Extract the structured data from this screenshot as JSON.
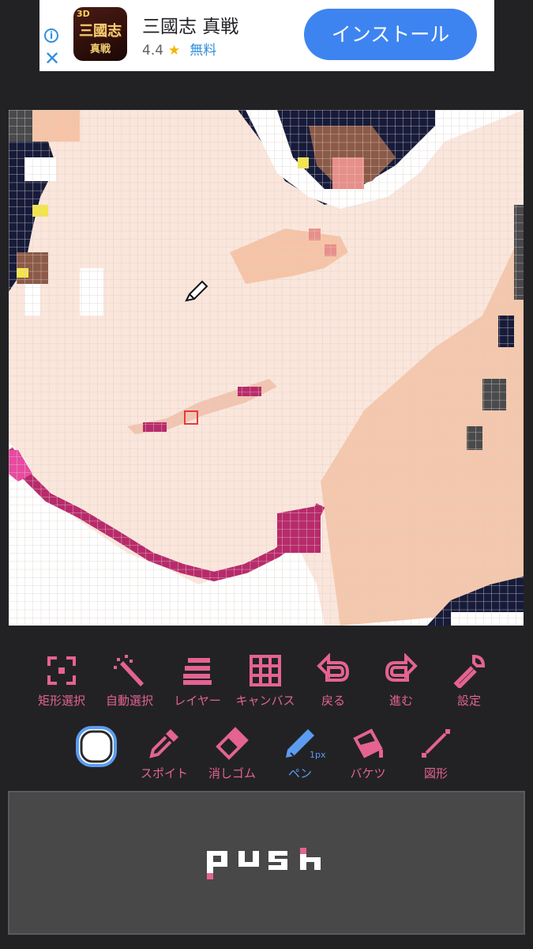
{
  "ad": {
    "app_name": "三國志 真戦",
    "rating": "4.4",
    "price": "無料",
    "install_label": "インストール",
    "icon_badge": "3D",
    "icon_title": "三國志",
    "icon_subtitle": "真戦"
  },
  "toolbar_row1": [
    {
      "label": "矩形選択",
      "icon": "rect-select-icon"
    },
    {
      "label": "自動選択",
      "icon": "magic-wand-icon"
    },
    {
      "label": "レイヤー",
      "icon": "layers-icon"
    },
    {
      "label": "キャンバス",
      "icon": "grid-icon"
    },
    {
      "label": "戻る",
      "icon": "undo-icon"
    },
    {
      "label": "進む",
      "icon": "redo-icon"
    },
    {
      "label": "設定",
      "icon": "wrench-icon"
    }
  ],
  "toolbar_row2": [
    {
      "label": "スポイト",
      "icon": "eyedropper-icon"
    },
    {
      "label": "消しゴム",
      "icon": "eraser-icon"
    },
    {
      "label": "ペン",
      "icon": "pen-icon",
      "active": true,
      "size": "1px"
    },
    {
      "label": "バケツ",
      "icon": "bucket-icon"
    },
    {
      "label": "図形",
      "icon": "line-shape-icon"
    }
  ],
  "current_color": "#ffffff",
  "push_label": "push",
  "colors": {
    "accent": "#e46391",
    "active": "#5b9cf0",
    "background": "#222225"
  }
}
